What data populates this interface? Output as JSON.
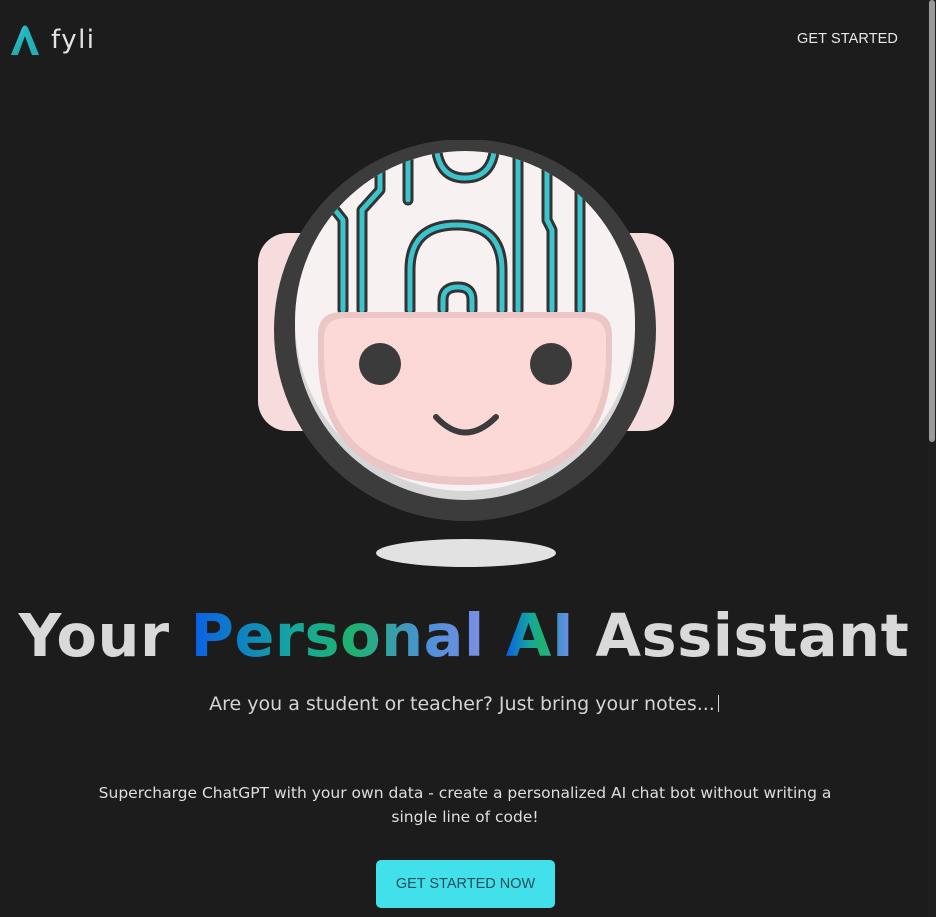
{
  "header": {
    "logo_text": "fyli",
    "nav_cta_label": "GET STARTED"
  },
  "hero": {
    "headline": {
      "word_1": "Your",
      "word_2": "Personal",
      "word_3": "AI",
      "word_4": "Assistant"
    },
    "subtitle": "Are you a student or teacher? Just bring your notes...",
    "description": "Supercharge ChatGPT with your own data - create a personalized AI chat bot without writing a single line of code!",
    "cta_label": "GET STARTED NOW"
  },
  "illustration": {
    "name": "robot-head",
    "colors": {
      "face": "#fcd8d6",
      "helmet": "#f7f0f0",
      "circuit": "#3cc4cc",
      "eyes": "#3b3b3b"
    }
  },
  "colors": {
    "background": "#1c1c1c",
    "accent": "#42e0ea",
    "gradient_start": "#0a5fe6",
    "gradient_end": "#7d8fe5",
    "text": "#d9d9d9"
  }
}
